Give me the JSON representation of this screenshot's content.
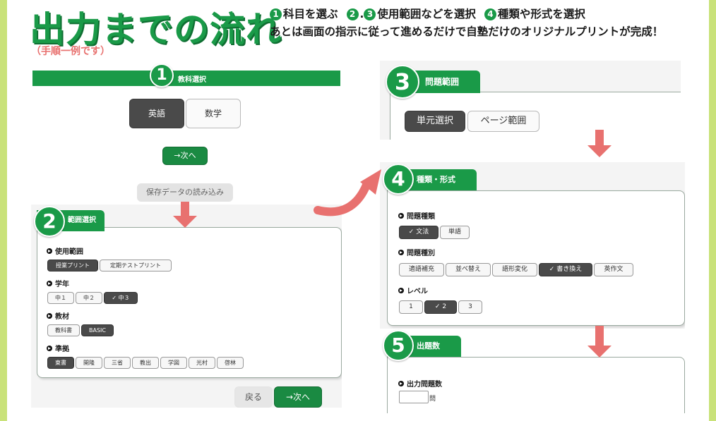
{
  "header": {
    "title": "出力までの流れ",
    "subtitle": "（手順一例です）",
    "step_line1": {
      "n1": "1",
      "t1": "科目を選ぶ",
      "n2": "2",
      "n3": "3",
      "t2": "使用範囲などを選択",
      "n4": "4",
      "t3": "種類や形式を選択"
    },
    "step_line2": "あとは画面の指示に従って進めるだけで自塾だけのオリジナルプリントが完成！"
  },
  "panel1": {
    "number": "1",
    "tab": "教科選択",
    "subjects": [
      "英語",
      "数学"
    ],
    "next": "→次へ",
    "load": "保存データの読み込み"
  },
  "panel2": {
    "number": "2",
    "tab": "範囲選択",
    "usage_label": "使用範囲",
    "usage_options": [
      "授業プリント",
      "定期テストプリント"
    ],
    "grade_label": "学年",
    "grade_options": [
      "中１",
      "中２",
      "✓ 中３"
    ],
    "material_label": "教材",
    "material_options": [
      "教科書",
      "BASIC"
    ],
    "standard_label": "準拠",
    "standard_options": [
      "東書",
      "開隆",
      "三省",
      "教出",
      "学図",
      "光村",
      "啓林"
    ],
    "back": "戻る",
    "next": "→次へ"
  },
  "panel3": {
    "number": "3",
    "tab": "問題範囲",
    "options": [
      "単元選択",
      "ページ範囲"
    ]
  },
  "panel4": {
    "number": "4",
    "tab": "種類・形式",
    "type_label": "問題種類",
    "type_options": [
      "✓ 文法",
      "単語"
    ],
    "kind_label": "問題種別",
    "kind_options": [
      "適語補充",
      "並べ替え",
      "語形変化",
      "✓ 書き換え",
      "英作文"
    ],
    "level_label": "レベル",
    "level_options": [
      "1",
      "✓ 2",
      "3"
    ]
  },
  "panel5": {
    "number": "5",
    "tab": "出題数",
    "count_label": "出力問題数",
    "count_value": "",
    "unit": "問"
  },
  "colors": {
    "green": "#1a9a48",
    "arrow": "#e8716f",
    "lime": "#c9e27a"
  }
}
